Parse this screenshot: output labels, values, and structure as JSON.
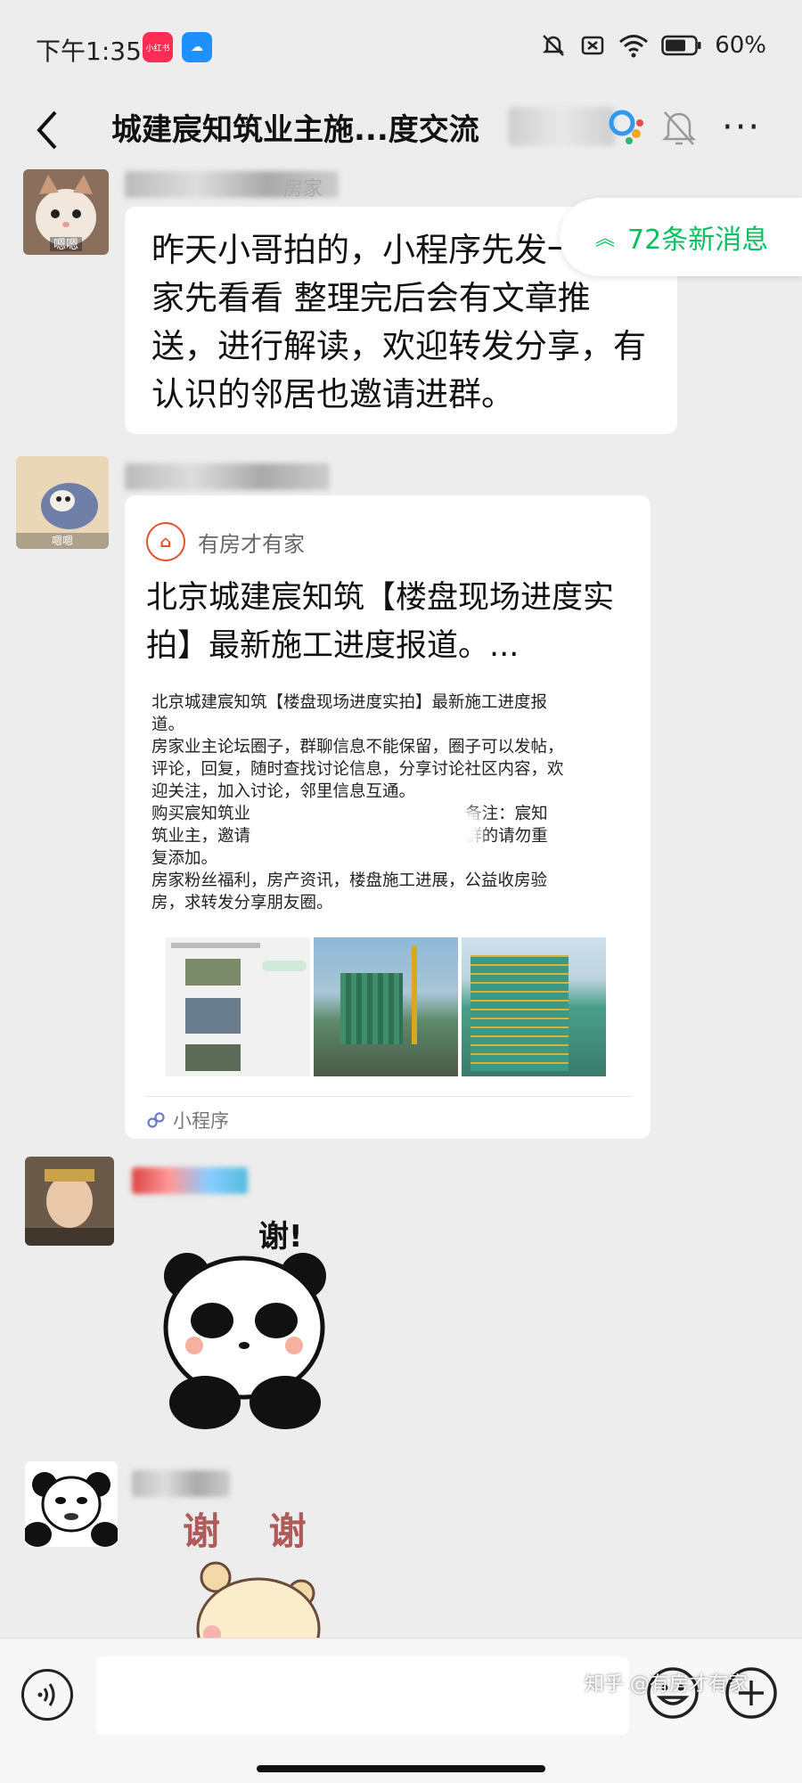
{
  "status_bar": {
    "time": "下午1:35",
    "app1": "小红书",
    "battery": "60%"
  },
  "chat": {
    "title": "城建宸知筑业主施...度交流"
  },
  "new_messages": {
    "label": "72条新消息"
  },
  "messages": [
    {
      "avatar_caption": "嗯嗯",
      "sender_suffix": "房家",
      "text": "昨天小哥拍的，小程序先发一下大家先看看 整理完后会有文章推送，进行解读，欢迎转发分享，有认识的邻居也邀请进群。"
    },
    {
      "avatar_caption": "嗯嗯",
      "card": {
        "source": "有房才有家",
        "title": "北京城建宸知筑【楼盘现场进度实拍】最新施工进度报道。...",
        "preview_lines": [
          "北京城建宸知筑【楼盘现场进度实拍】最新施工进度报",
          "道。",
          "房家业主论坛圈子，群聊信息不能保留，圈子可以发帖，",
          "评论，回复，随时查找讨论信息，分享讨论社区内容，欢",
          "迎关注，加入讨论，邻里信息互通。",
          "购买宸知筑业                                         备注：宸知",
          "筑业主，邀请                                         群的请勿重",
          "复添加。",
          "房家粉丝福利，房产资讯，楼盘施工进展，公益收房验",
          "房，求转发分享朋友圈。"
        ],
        "footer": "小程序"
      }
    },
    {
      "avatar_caption": "",
      "sticker_text": "谢!"
    },
    {
      "avatar_caption": "",
      "sticker_text": "谢 谢"
    }
  ],
  "watermark": "知乎 @有房才有家"
}
